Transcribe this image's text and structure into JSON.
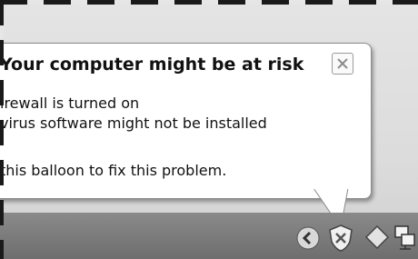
{
  "balloon": {
    "title": "Your computer might be at risk",
    "lines": [
      "irewall is turned on",
      "virus software might not be installed",
      "this balloon to fix this problem."
    ],
    "close_icon": "close-icon"
  },
  "tray": {
    "icons": [
      "chevron-left-icon",
      "security-shield-icon",
      "diamond-icon",
      "network-icon"
    ]
  },
  "colors": {
    "balloon_bg": "#ffffff",
    "taskbar": "#7a7a7a"
  }
}
